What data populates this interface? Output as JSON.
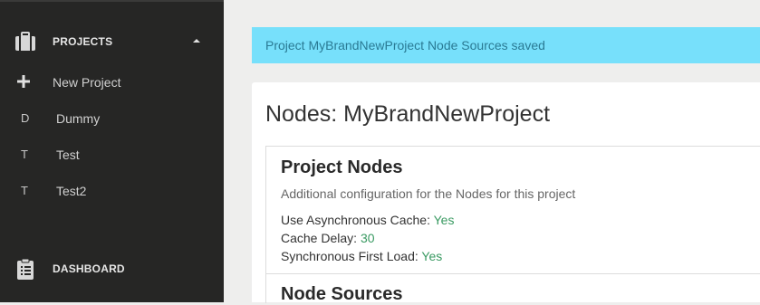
{
  "sidebar": {
    "projects_label": "PROJECTS",
    "new_project_label": "New Project",
    "projects": [
      {
        "letter": "D",
        "name": "Dummy"
      },
      {
        "letter": "T",
        "name": "Test"
      },
      {
        "letter": "T",
        "name": "Test2"
      }
    ],
    "dashboard_label": "DASHBOARD",
    "icons": {
      "projects": "briefcase-icon",
      "new_project": "plus-icon",
      "dashboard": "clipboard-icon",
      "collapse": "caret-up-icon"
    }
  },
  "alert": {
    "message": "Project MyBrandNewProject Node Sources saved",
    "color": "#77e0fb"
  },
  "main": {
    "title": "Nodes: MyBrandNewProject",
    "project_nodes": {
      "heading": "Project Nodes",
      "description": "Additional configuration for the Nodes for this project",
      "settings": [
        {
          "label": "Use Asynchronous Cache:",
          "value": "Yes"
        },
        {
          "label": "Cache Delay:",
          "value": "30"
        },
        {
          "label": "Synchronous First Load:",
          "value": "Yes"
        }
      ],
      "value_color": "#3a9a62"
    },
    "node_sources_heading": "Node Sources"
  }
}
